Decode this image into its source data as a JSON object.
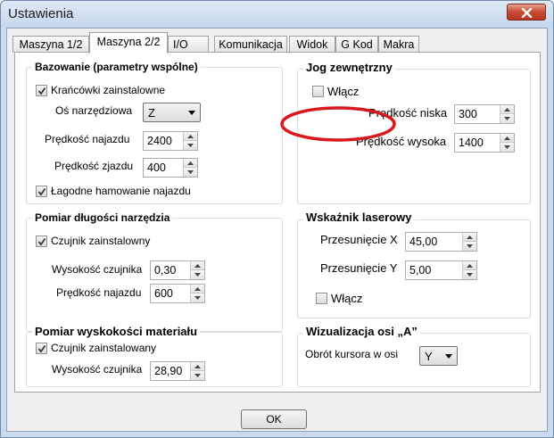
{
  "window": {
    "title": "Ustawienia"
  },
  "tabs": [
    {
      "label": "Maszyna 1/2"
    },
    {
      "label": "Maszyna 2/2"
    },
    {
      "label": "I/O"
    },
    {
      "label": "Komunikacja"
    },
    {
      "label": "Widok"
    },
    {
      "label": "G Kod"
    },
    {
      "label": "Makra"
    }
  ],
  "bazowanie": {
    "title": "Bazowanie (parametry wspólne)",
    "krancowki_label": "Krańcówki  zainstalowne",
    "krancowki_checked": true,
    "os_label": "Oś narzędziowa",
    "os_value": "Z",
    "predkosc_najazdu_label": "Prędkość najazdu",
    "predkosc_najazdu_value": "2400",
    "predkosc_zjazdu_label": "Prędkość zjazdu",
    "predkosc_zjazdu_value": "400",
    "lagodne_label": "Łagodne hamowanie najazdu",
    "lagodne_checked": true
  },
  "jog": {
    "title": "Jog zewnętrzny",
    "wlacz_label": "Włącz",
    "wlacz_checked": false,
    "niska_label": "Prędkość niska",
    "niska_value": "300",
    "wysoka_label": "Prędkość wysoka",
    "wysoka_value": "1400"
  },
  "pomiar_narzedzia": {
    "title": "Pomiar długości narzędzia",
    "czujnik_label": "Czujnik zainstalowny",
    "czujnik_checked": true,
    "wysokosc_label": "Wysokość czujnika",
    "wysokosc_value": "0,30",
    "predkosc_label": "Prędkość najazdu",
    "predkosc_value": "600"
  },
  "laser": {
    "title": "Wskaźnik laserowy",
    "x_label": "Przesunięcie X",
    "x_value": "45,00",
    "y_label": "Przesunięcie Y",
    "y_value": "5,00",
    "wlacz_label": "Włącz",
    "wlacz_checked": false
  },
  "pomiar_materialu": {
    "title": "Pomiar wyskokości materiału",
    "czujnik_label": "Czujnik zainstalowany",
    "czujnik_checked": true,
    "wysokosc_label": "Wysokość czujnika",
    "wysokosc_value": "28,90"
  },
  "wizualizacja": {
    "title": "Wizualizacja osi „A”",
    "obrot_label": "Obrót kursora w osi",
    "obrot_value": "Y"
  },
  "ok_label": "OK",
  "colors": {
    "annotation": "#d9181e",
    "check": "#3a3a3a"
  }
}
